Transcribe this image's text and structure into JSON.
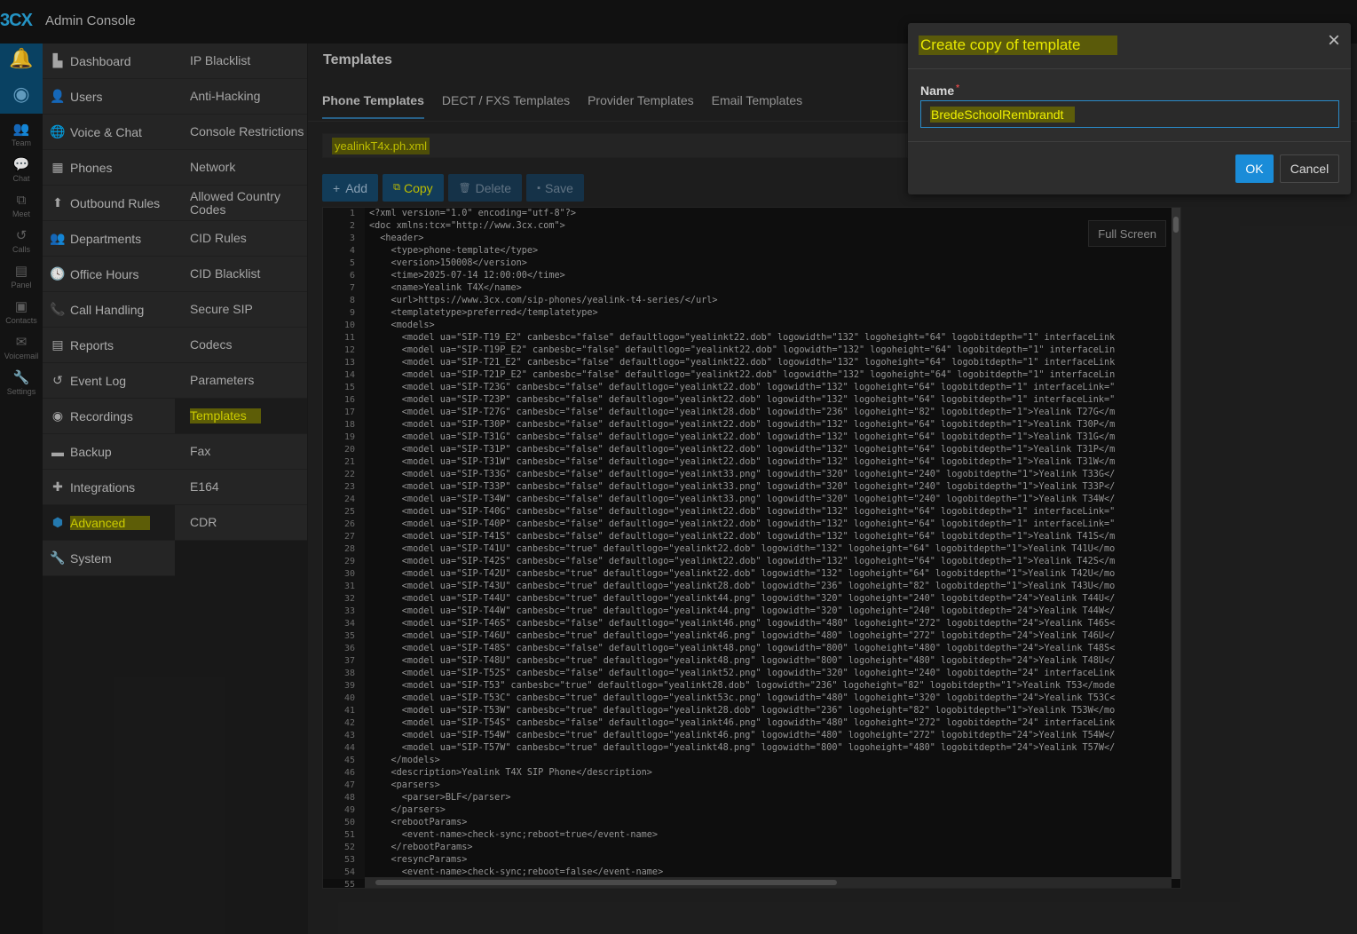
{
  "app": {
    "logo": "3CX",
    "title": "Admin Console"
  },
  "rail": [
    {
      "icon": "bell-icon",
      "label": ""
    },
    {
      "icon": "chrome-icon",
      "label": ""
    },
    {
      "icon": "team-icon",
      "label": "Team"
    },
    {
      "icon": "chat-icon",
      "label": "Chat"
    },
    {
      "icon": "meet-icon",
      "label": "Meet"
    },
    {
      "icon": "calls-icon",
      "label": "Calls"
    },
    {
      "icon": "panel-icon",
      "label": "Panel"
    },
    {
      "icon": "contacts-icon",
      "label": "Contacts"
    },
    {
      "icon": "voicemail-icon",
      "label": "Voicemail"
    },
    {
      "icon": "settings-icon",
      "label": "Settings"
    }
  ],
  "nav": [
    {
      "icon": "dashboard-icon",
      "label": "Dashboard"
    },
    {
      "icon": "user-icon",
      "label": "Users"
    },
    {
      "icon": "globe-icon",
      "label": "Voice & Chat"
    },
    {
      "icon": "phone-grid-icon",
      "label": "Phones"
    },
    {
      "icon": "arrow-up-icon",
      "label": "Outbound Rules"
    },
    {
      "icon": "departments-icon",
      "label": "Departments"
    },
    {
      "icon": "clock-icon",
      "label": "Office Hours"
    },
    {
      "icon": "handset-icon",
      "label": "Call Handling"
    },
    {
      "icon": "reports-icon",
      "label": "Reports"
    },
    {
      "icon": "history-icon",
      "label": "Event Log"
    },
    {
      "icon": "record-icon",
      "label": "Recordings"
    },
    {
      "icon": "archive-icon",
      "label": "Backup"
    },
    {
      "icon": "puzzle-icon",
      "label": "Integrations"
    },
    {
      "icon": "cube-icon",
      "label": "Advanced"
    },
    {
      "icon": "wrench-icon",
      "label": "System"
    }
  ],
  "subnav": [
    "IP Blacklist",
    "Anti-Hacking",
    "Console Restrictions",
    "Network",
    "Allowed Country Codes",
    "CID Rules",
    "CID Blacklist",
    "Secure SIP",
    "Codecs",
    "Parameters",
    "Templates",
    "Fax",
    "E164",
    "CDR"
  ],
  "page": {
    "title": "Templates",
    "tabs": [
      "Phone Templates",
      "DECT / FXS Templates",
      "Provider Templates",
      "Email Templates"
    ],
    "template_file": "yealinkT4x.ph.xml",
    "toolbar": {
      "add": "Add",
      "copy": "Copy",
      "delete": "Delete",
      "save": "Save"
    },
    "fullscreen": "Full Screen"
  },
  "editor": {
    "lines": [
      "<?xml version=\"1.0\" encoding=\"utf-8\"?>",
      "<doc xmlns:tcx=\"http://www.3cx.com\">",
      "  <header>",
      "    <type>phone-template</type>",
      "    <version>150008</version>",
      "    <time>2025-07-14 12:00:00</time>",
      "    <name>Yealink T4X</name>",
      "    <url>https://www.3cx.com/sip-phones/yealink-t4-series/</url>",
      "    <templatetype>preferred</templatetype>",
      "    <models>",
      "      <model ua=\"SIP-T19_E2\" canbesbc=\"false\" defaultlogo=\"yealinkt22.dob\" logowidth=\"132\" logoheight=\"64\" logobitdepth=\"1\" interfaceLink",
      "      <model ua=\"SIP-T19P_E2\" canbesbc=\"false\" defaultlogo=\"yealinkt22.dob\" logowidth=\"132\" logoheight=\"64\" logobitdepth=\"1\" interfaceLin",
      "      <model ua=\"SIP-T21_E2\" canbesbc=\"false\" defaultlogo=\"yealinkt22.dob\" logowidth=\"132\" logoheight=\"64\" logobitdepth=\"1\" interfaceLink",
      "      <model ua=\"SIP-T21P_E2\" canbesbc=\"false\" defaultlogo=\"yealinkt22.dob\" logowidth=\"132\" logoheight=\"64\" logobitdepth=\"1\" interfaceLin",
      "      <model ua=\"SIP-T23G\" canbesbc=\"false\" defaultlogo=\"yealinkt22.dob\" logowidth=\"132\" logoheight=\"64\" logobitdepth=\"1\" interfaceLink=\"",
      "      <model ua=\"SIP-T23P\" canbesbc=\"false\" defaultlogo=\"yealinkt22.dob\" logowidth=\"132\" logoheight=\"64\" logobitdepth=\"1\" interfaceLink=\"",
      "      <model ua=\"SIP-T27G\" canbesbc=\"false\" defaultlogo=\"yealinkt28.dob\" logowidth=\"236\" logoheight=\"82\" logobitdepth=\"1\">Yealink T27G</m",
      "      <model ua=\"SIP-T30P\" canbesbc=\"false\" defaultlogo=\"yealinkt22.dob\" logowidth=\"132\" logoheight=\"64\" logobitdepth=\"1\">Yealink T30P</m",
      "      <model ua=\"SIP-T31G\" canbesbc=\"false\" defaultlogo=\"yealinkt22.dob\" logowidth=\"132\" logoheight=\"64\" logobitdepth=\"1\">Yealink T31G</m",
      "      <model ua=\"SIP-T31P\" canbesbc=\"false\" defaultlogo=\"yealinkt22.dob\" logowidth=\"132\" logoheight=\"64\" logobitdepth=\"1\">Yealink T31P</m",
      "      <model ua=\"SIP-T31W\" canbesbc=\"false\" defaultlogo=\"yealinkt22.dob\" logowidth=\"132\" logoheight=\"64\" logobitdepth=\"1\">Yealink T31W</m",
      "      <model ua=\"SIP-T33G\" canbesbc=\"false\" defaultlogo=\"yealinkt33.png\" logowidth=\"320\" logoheight=\"240\" logobitdepth=\"1\">Yealink T33G</",
      "      <model ua=\"SIP-T33P\" canbesbc=\"false\" defaultlogo=\"yealinkt33.png\" logowidth=\"320\" logoheight=\"240\" logobitdepth=\"1\">Yealink T33P</",
      "      <model ua=\"SIP-T34W\" canbesbc=\"false\" defaultlogo=\"yealinkt33.png\" logowidth=\"320\" logoheight=\"240\" logobitdepth=\"1\">Yealink T34W</",
      "      <model ua=\"SIP-T40G\" canbesbc=\"false\" defaultlogo=\"yealinkt22.dob\" logowidth=\"132\" logoheight=\"64\" logobitdepth=\"1\" interfaceLink=\"",
      "      <model ua=\"SIP-T40P\" canbesbc=\"false\" defaultlogo=\"yealinkt22.dob\" logowidth=\"132\" logoheight=\"64\" logobitdepth=\"1\" interfaceLink=\"",
      "      <model ua=\"SIP-T41S\" canbesbc=\"false\" defaultlogo=\"yealinkt22.dob\" logowidth=\"132\" logoheight=\"64\" logobitdepth=\"1\">Yealink T41S</m",
      "      <model ua=\"SIP-T41U\" canbesbc=\"true\" defaultlogo=\"yealinkt22.dob\" logowidth=\"132\" logoheight=\"64\" logobitdepth=\"1\">Yealink T41U</mo",
      "      <model ua=\"SIP-T42S\" canbesbc=\"false\" defaultlogo=\"yealinkt22.dob\" logowidth=\"132\" logoheight=\"64\" logobitdepth=\"1\">Yealink T42S</m",
      "      <model ua=\"SIP-T42U\" canbesbc=\"true\" defaultlogo=\"yealinkt22.dob\" logowidth=\"132\" logoheight=\"64\" logobitdepth=\"1\">Yealink T42U</mo",
      "      <model ua=\"SIP-T43U\" canbesbc=\"true\" defaultlogo=\"yealinkt28.dob\" logowidth=\"236\" logoheight=\"82\" logobitdepth=\"1\">Yealink T43U</mo",
      "      <model ua=\"SIP-T44U\" canbesbc=\"true\" defaultlogo=\"yealinkt44.png\" logowidth=\"320\" logoheight=\"240\" logobitdepth=\"24\">Yealink T44U</",
      "      <model ua=\"SIP-T44W\" canbesbc=\"true\" defaultlogo=\"yealinkt44.png\" logowidth=\"320\" logoheight=\"240\" logobitdepth=\"24\">Yealink T44W</",
      "      <model ua=\"SIP-T46S\" canbesbc=\"false\" defaultlogo=\"yealinkt46.png\" logowidth=\"480\" logoheight=\"272\" logobitdepth=\"24\">Yealink T46S<",
      "      <model ua=\"SIP-T46U\" canbesbc=\"true\" defaultlogo=\"yealinkt46.png\" logowidth=\"480\" logoheight=\"272\" logobitdepth=\"24\">Yealink T46U</",
      "      <model ua=\"SIP-T48S\" canbesbc=\"false\" defaultlogo=\"yealinkt48.png\" logowidth=\"800\" logoheight=\"480\" logobitdepth=\"24\">Yealink T48S<",
      "      <model ua=\"SIP-T48U\" canbesbc=\"true\" defaultlogo=\"yealinkt48.png\" logowidth=\"800\" logoheight=\"480\" logobitdepth=\"24\">Yealink T48U</",
      "      <model ua=\"SIP-T52S\" canbesbc=\"false\" defaultlogo=\"yealinkt52.png\" logowidth=\"320\" logoheight=\"240\" logobitdepth=\"24\" interfaceLink",
      "      <model ua=\"SIP-T53\" canbesbc=\"true\" defaultlogo=\"yealinkt28.dob\" logowidth=\"236\" logoheight=\"82\" logobitdepth=\"1\">Yealink T53</mode",
      "      <model ua=\"SIP-T53C\" canbesbc=\"true\" defaultlogo=\"yealinkt53c.png\" logowidth=\"480\" logoheight=\"320\" logobitdepth=\"24\">Yealink T53C<",
      "      <model ua=\"SIP-T53W\" canbesbc=\"true\" defaultlogo=\"yealinkt28.dob\" logowidth=\"236\" logoheight=\"82\" logobitdepth=\"1\">Yealink T53W</mo",
      "      <model ua=\"SIP-T54S\" canbesbc=\"false\" defaultlogo=\"yealinkt46.png\" logowidth=\"480\" logoheight=\"272\" logobitdepth=\"24\" interfaceLink",
      "      <model ua=\"SIP-T54W\" canbesbc=\"true\" defaultlogo=\"yealinkt46.png\" logowidth=\"480\" logoheight=\"272\" logobitdepth=\"24\">Yealink T54W</",
      "      <model ua=\"SIP-T57W\" canbesbc=\"true\" defaultlogo=\"yealinkt48.png\" logowidth=\"800\" logoheight=\"480\" logobitdepth=\"24\">Yealink T57W</",
      "    </models>",
      "    <description>Yealink T4X SIP Phone</description>",
      "    <parsers>",
      "      <parser>BLF</parser>",
      "    </parsers>",
      "    <rebootParams>",
      "      <event-name>check-sync;reboot=true</event-name>",
      "    </rebootParams>",
      "    <resyncParams>",
      "      <event-name>check-sync;reboot=false</event-name>",
      ""
    ]
  },
  "modal": {
    "title": "Create copy of template",
    "name_label": "Name",
    "required_mark": "*",
    "name_value": "BredeSchoolRembrandt",
    "ok": "OK",
    "cancel": "Cancel",
    "close": "×"
  },
  "colors": {
    "accent": "#1a8cd8",
    "highlight": "#e6e600",
    "rail_active": "#0b4a70"
  }
}
